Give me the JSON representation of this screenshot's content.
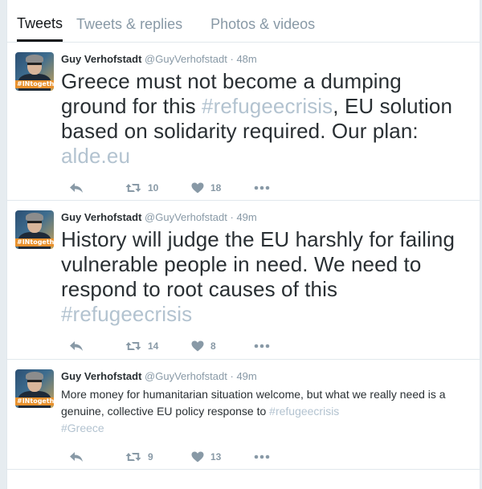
{
  "tabs": [
    {
      "label": "Tweets",
      "active": true
    },
    {
      "label": "Tweets & replies",
      "active": false
    },
    {
      "label": "Photos & videos",
      "active": false
    }
  ],
  "tweets": [
    {
      "name": "Guy Verhofstadt",
      "handle": "@GuyVerhofstadt",
      "dot": "·",
      "time": "48m",
      "size": "large",
      "text_before": "Greece must not become a dumping ground for this ",
      "hashtag": "#refugeecrisis",
      "text_after": ", EU solution based on solidarity required. Our plan: ",
      "link": "alde.eu",
      "retweets": "10",
      "likes": "18"
    },
    {
      "name": "Guy Verhofstadt",
      "handle": "@GuyVerhofstadt",
      "dot": "·",
      "time": "49m",
      "size": "large",
      "text_before": "History will judge the EU harshly for failing vulnerable people in need. We need to respond to root causes of this ",
      "hashtag": "#refugeecrisis",
      "text_after": "",
      "link": "",
      "retweets": "14",
      "likes": "8"
    },
    {
      "name": "Guy Verhofstadt",
      "handle": "@GuyVerhofstadt",
      "dot": "·",
      "time": "49m",
      "size": "small",
      "text_before": "More money for humanitarian situation welcome, but what we really need is a genuine, collective EU policy response to ",
      "hashtag": "#refugeecrisis",
      "text_after": " ",
      "link": "#Greece",
      "retweets": "9",
      "likes": "13"
    }
  ],
  "avatar_badge": "#INtogether",
  "colors": {
    "hashtag": "#b3c3d0",
    "icon": "#8899a6",
    "text": "#292f33"
  },
  "icons": {
    "reply": "reply-icon",
    "retweet": "retweet-icon",
    "like": "heart-icon",
    "more": "more-icon"
  }
}
